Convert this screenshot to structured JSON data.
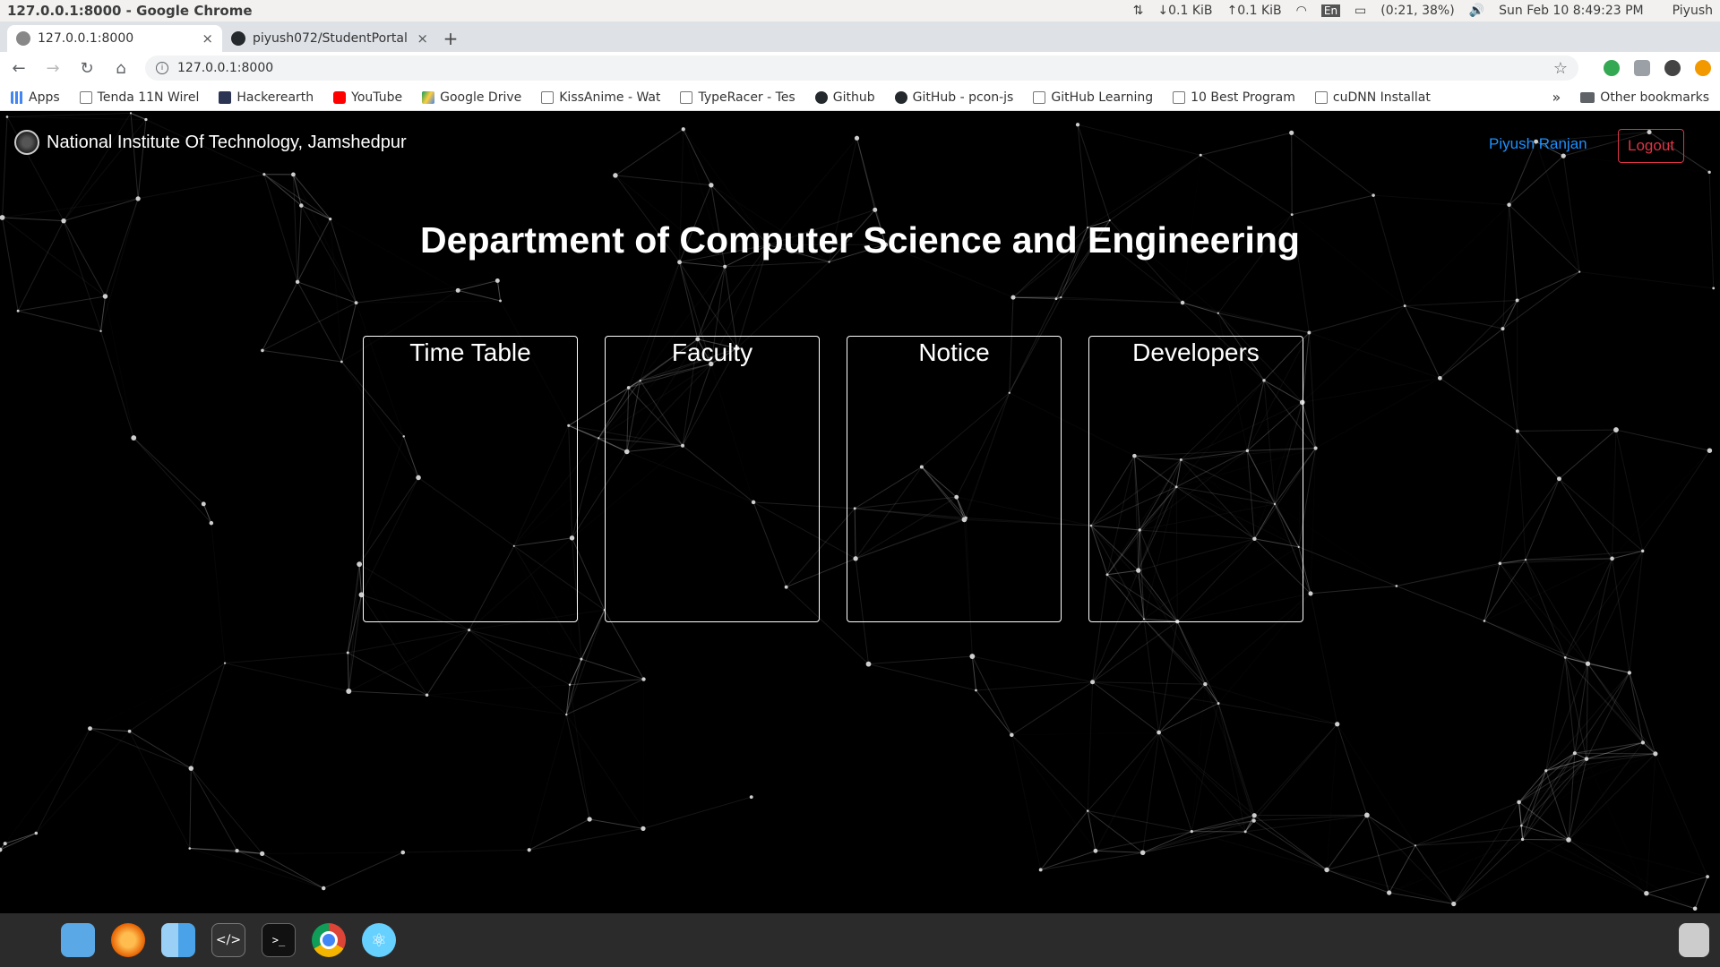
{
  "window_title": "127.0.0.1:8000 - Google Chrome",
  "system_tray": {
    "network_down": "↓0.1 KiB",
    "network_up": "↑0.1 KiB",
    "keyboard": "En",
    "battery": "(0:21, 38%)",
    "datetime": "Sun Feb 10  8:49:23 PM",
    "user": "Piyush"
  },
  "tabs": [
    {
      "label": "127.0.0.1:8000",
      "close": "×"
    },
    {
      "label": "piyush072/StudentPortal",
      "close": "×"
    }
  ],
  "new_tab": "+",
  "address_bar": {
    "url": "127.0.0.1:8000"
  },
  "bookmarks": {
    "apps": "Apps",
    "items": [
      "Tenda 11N Wirel",
      "Hackerearth",
      "YouTube",
      "Google Drive",
      "KissAnime - Wat",
      "TypeRacer - Tes",
      "Github",
      "GitHub - pcon-js",
      "GitHub Learning",
      "10 Best Program",
      "cuDNN Installat"
    ],
    "more": "»",
    "other": "Other bookmarks"
  },
  "navbar": {
    "brand": "National Institute Of Technology, Jamshedpur",
    "user": "Piyush Ranjan",
    "logout": "Logout"
  },
  "page_title": "Department of Computer Science and Engineering",
  "cards": [
    "Time Table",
    "Faculty",
    "Notice",
    "Developers"
  ],
  "colors": {
    "link": "#1e90ff",
    "logout": "#dc3545",
    "background": "#000000"
  }
}
